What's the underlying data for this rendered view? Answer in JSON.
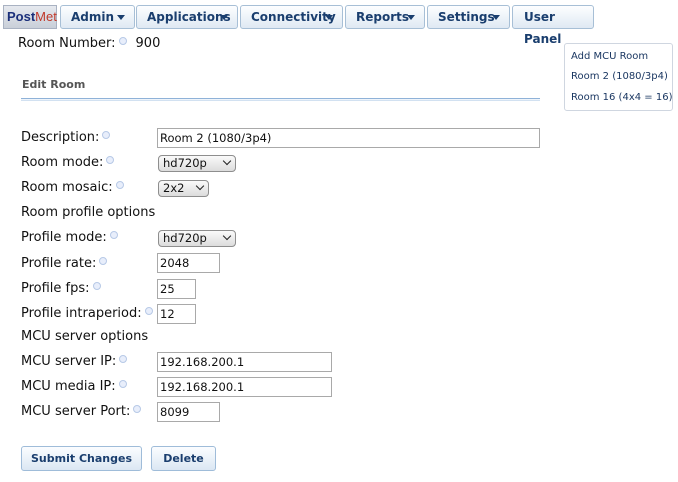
{
  "nav": {
    "logo_part1": "Post",
    "logo_part2": "Met",
    "items": [
      "Admin",
      "Applications",
      "Connectivity",
      "Reports",
      "Settings"
    ],
    "user_panel": "User Panel"
  },
  "room": {
    "number_label": "Room Number:",
    "number_value": "900"
  },
  "section_title": "Edit Room",
  "side_panel": {
    "links": [
      "Add MCU Room",
      "Room 2 (1080/3p4)",
      "Room 16 (4x4 = 16)"
    ]
  },
  "form": {
    "description_label": "Description:",
    "description_value": "Room 2 (1080/3p4)",
    "room_mode_label": "Room mode:",
    "room_mode_value": "hd720p",
    "room_mosaic_label": "Room mosaic:",
    "room_mosaic_value": "2x2",
    "profile_section": "Room profile options",
    "profile_mode_label": "Profile mode:",
    "profile_mode_value": "hd720p",
    "profile_rate_label": "Profile rate:",
    "profile_rate_value": "2048",
    "profile_fps_label": "Profile fps:",
    "profile_fps_value": "25",
    "profile_intraperiod_label": "Profile intraperiod:",
    "profile_intraperiod_value": "12",
    "mcu_section": "MCU server options",
    "mcu_ip_label": "MCU server IP:",
    "mcu_ip_value": "192.168.200.1",
    "mcu_media_ip_label": "MCU media IP:",
    "mcu_media_ip_value": "192.168.200.1",
    "mcu_port_label": "MCU server Port:",
    "mcu_port_value": "8099"
  },
  "actions": {
    "submit": "Submit Changes",
    "delete": "Delete"
  }
}
